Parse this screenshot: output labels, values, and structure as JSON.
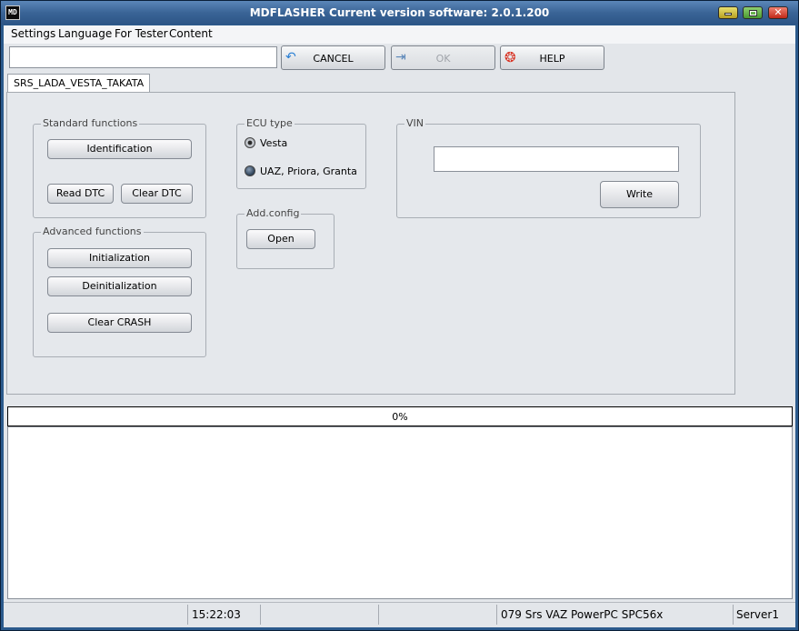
{
  "window": {
    "title": "MDFLASHER  Current version software: 2.0.1.200",
    "app_icon_text": "MD"
  },
  "menu": [
    "Settings",
    "Language",
    "For Tester",
    "Content"
  ],
  "toolbar": {
    "input_value": "",
    "cancel_label": "CANCEL",
    "ok_label": "OK",
    "help_label": "HELP"
  },
  "tab": {
    "label": "SRS_LADA_VESTA_TAKATA"
  },
  "standard_functions": {
    "title": "Standard functions",
    "identification": "Identification",
    "read_dtc": "Read DTC",
    "clear_dtc": "Clear DTC"
  },
  "advanced_functions": {
    "title": "Advanced functions",
    "initialization": "Initialization",
    "deinitialization": "Deinitialization",
    "clear_crash": "Clear CRASH"
  },
  "ecu_type": {
    "title": "ECU type",
    "options": [
      "Vesta",
      "UAZ, Priora, Granta"
    ],
    "selected": "Vesta"
  },
  "add_config": {
    "title": "Add.config",
    "open": "Open"
  },
  "vin": {
    "title": "VIN",
    "value": "",
    "write": "Write"
  },
  "progress": {
    "percent": 0,
    "text": "0%"
  },
  "status": {
    "time": "15:22:03",
    "device": "079 Srs VAZ PowerPC SPC56x",
    "server": "Server1"
  },
  "colors": {
    "titlebar": "#3a6496",
    "progress_fill": "#3a7bd5"
  },
  "icons": {
    "cancel": "undo-arrow-icon",
    "ok": "exit-door-icon",
    "help": "lifebuoy-icon"
  }
}
